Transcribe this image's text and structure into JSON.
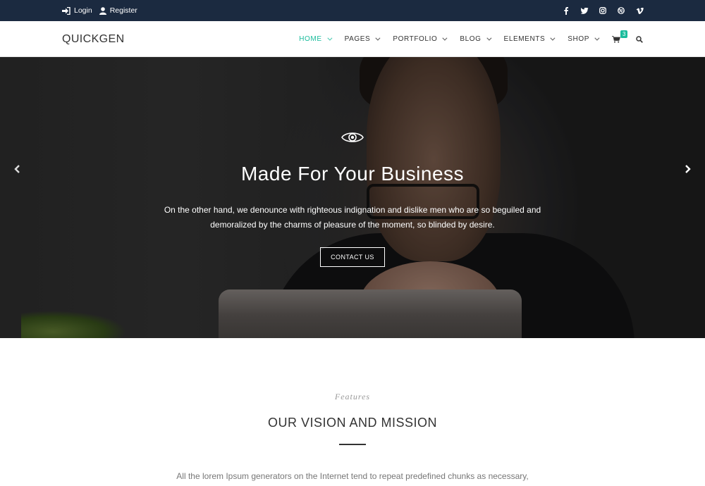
{
  "topbar": {
    "login_label": "Login",
    "register_label": "Register",
    "social_icons": [
      "facebook-icon",
      "twitter-icon",
      "instagram-icon",
      "dribbble-icon",
      "vimeo-icon"
    ]
  },
  "header": {
    "logo": "QUICKGEN",
    "nav": [
      {
        "label": "HOME",
        "active": true
      },
      {
        "label": "PAGES"
      },
      {
        "label": "PORTFOLIO"
      },
      {
        "label": "BLOG"
      },
      {
        "label": "ELEMENTS"
      },
      {
        "label": "SHOP"
      }
    ],
    "cart_count": "3"
  },
  "hero": {
    "title": "Made For Your Business",
    "text": "On the other hand, we denounce with righteous indignation and dislike men who are so beguiled and demoralized by the charms of pleasure of the moment, so blinded by desire.",
    "cta_label": "CONTACT US"
  },
  "features": {
    "eyebrow": "Features",
    "title": "OUR VISION AND MISSION",
    "description": "All the lorem Ipsum generators on the Internet tend to repeat predefined chunks as necessary,"
  },
  "colors": {
    "accent": "#1abc9c",
    "topbar": "#1b2a40",
    "text": "#333333"
  }
}
